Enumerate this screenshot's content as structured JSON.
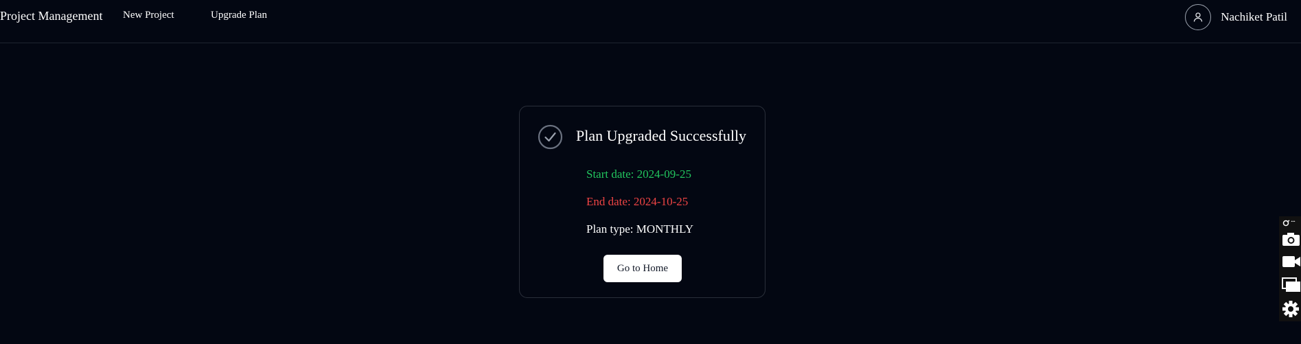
{
  "navbar": {
    "brand": "Project Management",
    "links": [
      "New Project",
      "Upgrade Plan"
    ],
    "user_name": "Nachiket Patil",
    "icons": {
      "avatar": "user-icon"
    }
  },
  "card": {
    "title": "Plan Upgraded Successfully",
    "icon": "check-circle-icon",
    "start_date": "Start date: 2024-09-25",
    "end_date": "End date: 2024-10-25",
    "plan_type": "Plan type: MONTHLY",
    "button_label": "Go to Home"
  },
  "side_toolbar": {
    "icons": [
      "link-icon",
      "more-icon",
      "camera-icon",
      "video-icon",
      "windows-icon",
      "settings-icon"
    ],
    "more_label": "..."
  },
  "colors": {
    "background": "#030712",
    "start_date": "#22c55e",
    "end_date": "#ef4444",
    "button_bg": "#ffffff"
  }
}
